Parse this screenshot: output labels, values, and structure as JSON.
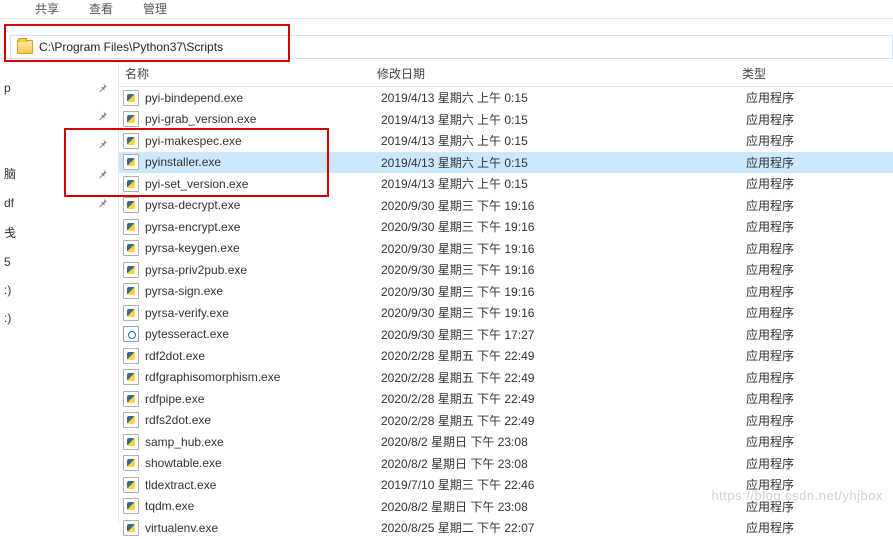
{
  "menu": {
    "share": "共享",
    "view": "查看",
    "manage": "管理"
  },
  "address": {
    "path": "C:\\Program Files\\Python37\\Scripts"
  },
  "columns": {
    "name": "名称",
    "modified": "修改日期",
    "type": "类型"
  },
  "sidebar": {
    "items": [
      {
        "label": "p"
      },
      {
        "label": ""
      },
      {
        "label": ""
      },
      {
        "label": "脑"
      },
      {
        "label": "df"
      },
      {
        "label": "戋"
      },
      {
        "label": "5"
      },
      {
        "label": ":)"
      },
      {
        "label": ":)"
      }
    ]
  },
  "files": [
    {
      "name": "pyi-bindepend.exe",
      "date": "2019/4/13 星期六 上午 0:15",
      "type": "应用程序",
      "icon": "py",
      "selected": false
    },
    {
      "name": "pyi-grab_version.exe",
      "date": "2019/4/13 星期六 上午 0:15",
      "type": "应用程序",
      "icon": "py",
      "selected": false
    },
    {
      "name": "pyi-makespec.exe",
      "date": "2019/4/13 星期六 上午 0:15",
      "type": "应用程序",
      "icon": "py",
      "selected": false
    },
    {
      "name": "pyinstaller.exe",
      "date": "2019/4/13 星期六 上午 0:15",
      "type": "应用程序",
      "icon": "py",
      "selected": true
    },
    {
      "name": "pyi-set_version.exe",
      "date": "2019/4/13 星期六 上午 0:15",
      "type": "应用程序",
      "icon": "py",
      "selected": false
    },
    {
      "name": "pyrsa-decrypt.exe",
      "date": "2020/9/30 星期三 下午 19:16",
      "type": "应用程序",
      "icon": "py",
      "selected": false
    },
    {
      "name": "pyrsa-encrypt.exe",
      "date": "2020/9/30 星期三 下午 19:16",
      "type": "应用程序",
      "icon": "py",
      "selected": false
    },
    {
      "name": "pyrsa-keygen.exe",
      "date": "2020/9/30 星期三 下午 19:16",
      "type": "应用程序",
      "icon": "py",
      "selected": false
    },
    {
      "name": "pyrsa-priv2pub.exe",
      "date": "2020/9/30 星期三 下午 19:16",
      "type": "应用程序",
      "icon": "py",
      "selected": false
    },
    {
      "name": "pyrsa-sign.exe",
      "date": "2020/9/30 星期三 下午 19:16",
      "type": "应用程序",
      "icon": "py",
      "selected": false
    },
    {
      "name": "pyrsa-verify.exe",
      "date": "2020/9/30 星期三 下午 19:16",
      "type": "应用程序",
      "icon": "py",
      "selected": false
    },
    {
      "name": "pytesseract.exe",
      "date": "2020/9/30 星期三 下午 17:27",
      "type": "应用程序",
      "icon": "cfg",
      "selected": false
    },
    {
      "name": "rdf2dot.exe",
      "date": "2020/2/28 星期五 下午 22:49",
      "type": "应用程序",
      "icon": "py",
      "selected": false
    },
    {
      "name": "rdfgraphisomorphism.exe",
      "date": "2020/2/28 星期五 下午 22:49",
      "type": "应用程序",
      "icon": "py",
      "selected": false
    },
    {
      "name": "rdfpipe.exe",
      "date": "2020/2/28 星期五 下午 22:49",
      "type": "应用程序",
      "icon": "py",
      "selected": false
    },
    {
      "name": "rdfs2dot.exe",
      "date": "2020/2/28 星期五 下午 22:49",
      "type": "应用程序",
      "icon": "py",
      "selected": false
    },
    {
      "name": "samp_hub.exe",
      "date": "2020/8/2 星期日 下午 23:08",
      "type": "应用程序",
      "icon": "py",
      "selected": false
    },
    {
      "name": "showtable.exe",
      "date": "2020/8/2 星期日 下午 23:08",
      "type": "应用程序",
      "icon": "py",
      "selected": false
    },
    {
      "name": "tldextract.exe",
      "date": "2019/7/10 星期三 下午 22:46",
      "type": "应用程序",
      "icon": "py",
      "selected": false
    },
    {
      "name": "tqdm.exe",
      "date": "2020/8/2 星期日 下午 23:08",
      "type": "应用程序",
      "icon": "py",
      "selected": false
    },
    {
      "name": "virtualenv.exe",
      "date": "2020/8/25 星期二 下午 22:07",
      "type": "应用程序",
      "icon": "py",
      "selected": false
    }
  ],
  "highlights": {
    "address": {
      "enabled": true
    },
    "file_group": {
      "start_index": 2,
      "end_index": 4
    }
  },
  "watermark": "https://blog.csdn.net/yhjbox"
}
